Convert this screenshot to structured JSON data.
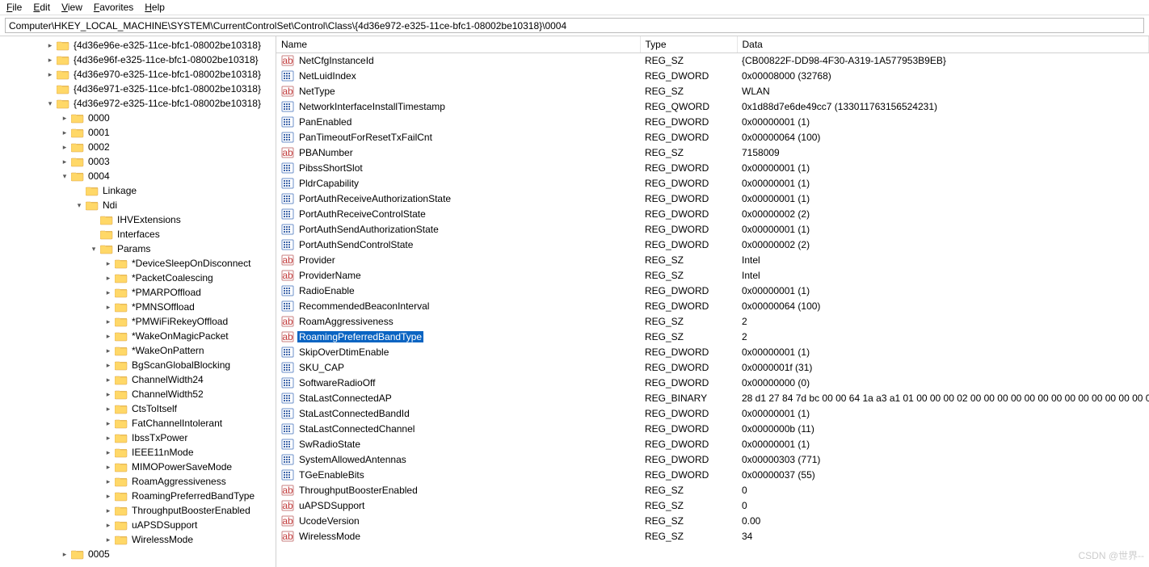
{
  "menu": {
    "file": "File",
    "edit": "Edit",
    "view": "View",
    "favorites": "Favorites",
    "help": "Help"
  },
  "address": "Computer\\HKEY_LOCAL_MACHINE\\SYSTEM\\CurrentControlSet\\Control\\Class\\{4d36e972-e325-11ce-bfc1-08002be10318}\\0004",
  "cols": {
    "name": "Name",
    "type": "Type",
    "data": "Data"
  },
  "watermark": "CSDN @世界--",
  "tree": [
    {
      "indent": 3,
      "tw": "closed",
      "label": "{4d36e96e-e325-11ce-bfc1-08002be10318}"
    },
    {
      "indent": 3,
      "tw": "closed",
      "label": "{4d36e96f-e325-11ce-bfc1-08002be10318}"
    },
    {
      "indent": 3,
      "tw": "closed",
      "label": "{4d36e970-e325-11ce-bfc1-08002be10318}"
    },
    {
      "indent": 3,
      "tw": "none",
      "label": "{4d36e971-e325-11ce-bfc1-08002be10318}"
    },
    {
      "indent": 3,
      "tw": "open",
      "label": "{4d36e972-e325-11ce-bfc1-08002be10318}"
    },
    {
      "indent": 4,
      "tw": "closed",
      "label": "0000"
    },
    {
      "indent": 4,
      "tw": "closed",
      "label": "0001"
    },
    {
      "indent": 4,
      "tw": "closed",
      "label": "0002"
    },
    {
      "indent": 4,
      "tw": "closed",
      "label": "0003"
    },
    {
      "indent": 4,
      "tw": "open",
      "label": "0004"
    },
    {
      "indent": 5,
      "tw": "none",
      "label": "Linkage"
    },
    {
      "indent": 5,
      "tw": "open",
      "label": "Ndi"
    },
    {
      "indent": 6,
      "tw": "none",
      "label": "IHVExtensions"
    },
    {
      "indent": 6,
      "tw": "none",
      "label": "Interfaces"
    },
    {
      "indent": 6,
      "tw": "open",
      "label": "Params"
    },
    {
      "indent": 7,
      "tw": "closed",
      "label": "*DeviceSleepOnDisconnect"
    },
    {
      "indent": 7,
      "tw": "closed",
      "label": "*PacketCoalescing"
    },
    {
      "indent": 7,
      "tw": "closed",
      "label": "*PMARPOffload"
    },
    {
      "indent": 7,
      "tw": "closed",
      "label": "*PMNSOffload"
    },
    {
      "indent": 7,
      "tw": "closed",
      "label": "*PMWiFiRekeyOffload"
    },
    {
      "indent": 7,
      "tw": "closed",
      "label": "*WakeOnMagicPacket"
    },
    {
      "indent": 7,
      "tw": "closed",
      "label": "*WakeOnPattern"
    },
    {
      "indent": 7,
      "tw": "closed",
      "label": "BgScanGlobalBlocking"
    },
    {
      "indent": 7,
      "tw": "closed",
      "label": "ChannelWidth24"
    },
    {
      "indent": 7,
      "tw": "closed",
      "label": "ChannelWidth52"
    },
    {
      "indent": 7,
      "tw": "closed",
      "label": "CtsToItself"
    },
    {
      "indent": 7,
      "tw": "closed",
      "label": "FatChannelIntolerant"
    },
    {
      "indent": 7,
      "tw": "closed",
      "label": "IbssTxPower"
    },
    {
      "indent": 7,
      "tw": "closed",
      "label": "IEEE11nMode"
    },
    {
      "indent": 7,
      "tw": "closed",
      "label": "MIMOPowerSaveMode"
    },
    {
      "indent": 7,
      "tw": "closed",
      "label": "RoamAggressiveness"
    },
    {
      "indent": 7,
      "tw": "closed",
      "label": "RoamingPreferredBandType"
    },
    {
      "indent": 7,
      "tw": "closed",
      "label": "ThroughputBoosterEnabled"
    },
    {
      "indent": 7,
      "tw": "closed",
      "label": "uAPSDSupport"
    },
    {
      "indent": 7,
      "tw": "closed",
      "label": "WirelessMode"
    },
    {
      "indent": 4,
      "tw": "closed",
      "label": "0005"
    }
  ],
  "values": [
    {
      "name": "NetCfgInstanceId",
      "type": "REG_SZ",
      "data": "{CB00822F-DD98-4F30-A319-1A577953B9EB}",
      "kind": "sz"
    },
    {
      "name": "NetLuidIndex",
      "type": "REG_DWORD",
      "data": "0x00008000 (32768)",
      "kind": "bin"
    },
    {
      "name": "NetType",
      "type": "REG_SZ",
      "data": "WLAN",
      "kind": "sz"
    },
    {
      "name": "NetworkInterfaceInstallTimestamp",
      "type": "REG_QWORD",
      "data": "0x1d88d7e6de49cc7 (133011763156524231)",
      "kind": "bin"
    },
    {
      "name": "PanEnabled",
      "type": "REG_DWORD",
      "data": "0x00000001 (1)",
      "kind": "bin"
    },
    {
      "name": "PanTimeoutForResetTxFailCnt",
      "type": "REG_DWORD",
      "data": "0x00000064 (100)",
      "kind": "bin"
    },
    {
      "name": "PBANumber",
      "type": "REG_SZ",
      "data": "7158009",
      "kind": "sz"
    },
    {
      "name": "PibssShortSlot",
      "type": "REG_DWORD",
      "data": "0x00000001 (1)",
      "kind": "bin"
    },
    {
      "name": "PldrCapability",
      "type": "REG_DWORD",
      "data": "0x00000001 (1)",
      "kind": "bin"
    },
    {
      "name": "PortAuthReceiveAuthorizationState",
      "type": "REG_DWORD",
      "data": "0x00000001 (1)",
      "kind": "bin"
    },
    {
      "name": "PortAuthReceiveControlState",
      "type": "REG_DWORD",
      "data": "0x00000002 (2)",
      "kind": "bin"
    },
    {
      "name": "PortAuthSendAuthorizationState",
      "type": "REG_DWORD",
      "data": "0x00000001 (1)",
      "kind": "bin"
    },
    {
      "name": "PortAuthSendControlState",
      "type": "REG_DWORD",
      "data": "0x00000002 (2)",
      "kind": "bin"
    },
    {
      "name": "Provider",
      "type": "REG_SZ",
      "data": "Intel",
      "kind": "sz"
    },
    {
      "name": "ProviderName",
      "type": "REG_SZ",
      "data": "Intel",
      "kind": "sz"
    },
    {
      "name": "RadioEnable",
      "type": "REG_DWORD",
      "data": "0x00000001 (1)",
      "kind": "bin"
    },
    {
      "name": "RecommendedBeaconInterval",
      "type": "REG_DWORD",
      "data": "0x00000064 (100)",
      "kind": "bin"
    },
    {
      "name": "RoamAggressiveness",
      "type": "REG_SZ",
      "data": "2",
      "kind": "sz"
    },
    {
      "name": "RoamingPreferredBandType",
      "type": "REG_SZ",
      "data": "2",
      "kind": "sz",
      "selected": true
    },
    {
      "name": "SkipOverDtimEnable",
      "type": "REG_DWORD",
      "data": "0x00000001 (1)",
      "kind": "bin"
    },
    {
      "name": "SKU_CAP",
      "type": "REG_DWORD",
      "data": "0x0000001f (31)",
      "kind": "bin"
    },
    {
      "name": "SoftwareRadioOff",
      "type": "REG_DWORD",
      "data": "0x00000000 (0)",
      "kind": "bin"
    },
    {
      "name": "StaLastConnectedAP",
      "type": "REG_BINARY",
      "data": "28 d1 27 84 7d bc 00 00 64 1a a3 a1 01 00 00 00 02 00 00 00 00 00 00 00 00 00 00 00 00 00 0",
      "kind": "bin"
    },
    {
      "name": "StaLastConnectedBandId",
      "type": "REG_DWORD",
      "data": "0x00000001 (1)",
      "kind": "bin"
    },
    {
      "name": "StaLastConnectedChannel",
      "type": "REG_DWORD",
      "data": "0x0000000b (11)",
      "kind": "bin"
    },
    {
      "name": "SwRadioState",
      "type": "REG_DWORD",
      "data": "0x00000001 (1)",
      "kind": "bin"
    },
    {
      "name": "SystemAllowedAntennas",
      "type": "REG_DWORD",
      "data": "0x00000303 (771)",
      "kind": "bin"
    },
    {
      "name": "TGeEnableBits",
      "type": "REG_DWORD",
      "data": "0x00000037 (55)",
      "kind": "bin"
    },
    {
      "name": "ThroughputBoosterEnabled",
      "type": "REG_SZ",
      "data": "0",
      "kind": "sz"
    },
    {
      "name": "uAPSDSupport",
      "type": "REG_SZ",
      "data": "0",
      "kind": "sz"
    },
    {
      "name": "UcodeVersion",
      "type": "REG_SZ",
      "data": "0.00",
      "kind": "sz"
    },
    {
      "name": "WirelessMode",
      "type": "REG_SZ",
      "data": "34",
      "kind": "sz"
    }
  ]
}
